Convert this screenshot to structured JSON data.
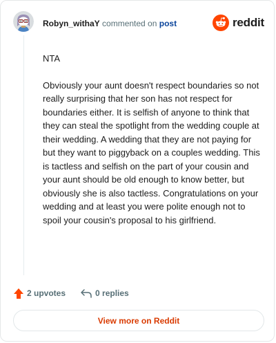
{
  "header": {
    "username": "Robyn_withaY",
    "action_text": "commented on",
    "post_link": "post",
    "brand": "reddit"
  },
  "comment": {
    "paragraphs": [
      "NTA",
      "Obviously your aunt doesn't respect boundaries so not really surprising that her son has not respect for boundaries either. It is selfish of anyone to think that they can steal the spotlight from the wedding couple at their wedding. A wedding that they are not paying for but they want to piggyback on a couples wedding. This is tactless and selfish on the part of your cousin and your aunt should be old enough to know better, but obviously she is also tactless. Congratulations on your wedding and at least you were polite enough not to spoil your cousin's proposal to his girlfriend."
    ]
  },
  "meta": {
    "upvotes": "2 upvotes",
    "replies": "0 replies"
  },
  "footer": {
    "view_more": "View more on Reddit"
  },
  "icons": {
    "avatar": "snoo-avatar-icon",
    "brand_logo": "reddit-logo-icon",
    "upvote": "upvote-arrow-icon",
    "reply": "reply-arrow-icon"
  },
  "colors": {
    "brand_orange": "#ff4500",
    "post_link": "#0a449b",
    "muted_text": "#576f76",
    "upvote_arrow": "#ff4500",
    "view_more_text": "#d93a00"
  }
}
